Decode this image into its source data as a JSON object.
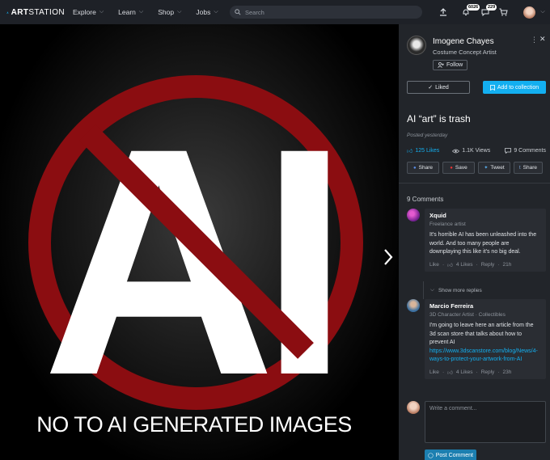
{
  "header": {
    "logo_text_bold": "ART",
    "logo_text_rest": "STATION",
    "nav": [
      {
        "label": "Explore"
      },
      {
        "label": "Learn"
      },
      {
        "label": "Shop"
      },
      {
        "label": "Jobs"
      }
    ],
    "search_placeholder": "Search",
    "notifications_badge": "6026",
    "messages_badge": "229"
  },
  "artwork": {
    "letters": "AI",
    "caption": "NO TO AI GENERATED IMAGES",
    "colors": {
      "ring": "#8b0d11",
      "letters": "#ffffff"
    }
  },
  "author": {
    "name": "Imogene Chayes",
    "title": "Costume Concept Artist",
    "follow_label": "Follow"
  },
  "actions": {
    "liked_label": "Liked",
    "collection_label": "Add to collection"
  },
  "post": {
    "title": "AI “art” is trash",
    "posted": "Posted yesterday",
    "likes": "125 Likes",
    "views": "1.1K Views",
    "comments": "9 Comments"
  },
  "share": {
    "facebook": "Share",
    "pinterest": "Save",
    "twitter": "Tweet",
    "tumblr": "Share"
  },
  "comments_header": "9 Comments",
  "comments": [
    {
      "name": "Xquid",
      "role": "Freelance artist",
      "body": "It's horrible AI has been unleashed into the world. And too many people are downplaying this like it's no big deal.",
      "like": "Like",
      "likes": "4 Likes",
      "reply": "Reply",
      "time": "21h"
    },
    {
      "name": "Marcio Ferreira",
      "role": "3D Character Artist · Collectibles",
      "body": "I'm going to leave here an article from the 3d scan store that talks about how to prevent AI",
      "link": "https://www.3dscanstore.com/blog/News/4-ways-to-protect-your-artwork-from-AI",
      "like": "Like",
      "likes": "4 Likes",
      "reply": "Reply",
      "time": "23h"
    }
  ],
  "show_more": "Show more replies",
  "write": {
    "placeholder": "Write a comment...",
    "post_label": "Post Comment"
  },
  "colors": {
    "accent": "#13aff0",
    "panel_bg": "#22252a",
    "topbar_bg": "#1e2127"
  }
}
